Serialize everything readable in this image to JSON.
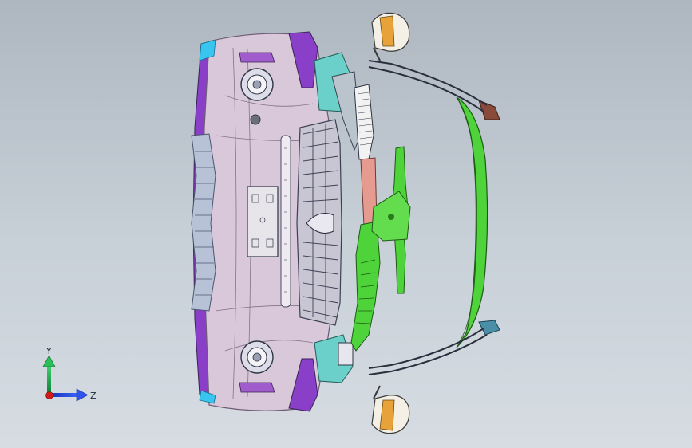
{
  "viewport": {
    "background_top": "#aeb7c0",
    "background_bottom": "#d6dce2"
  },
  "model": {
    "colors": {
      "bumper": "#d8c8da",
      "bumper_edge": "#7b6a80",
      "purple_trim": "#8a3fc8",
      "grille": "#c9c6d4",
      "green_panel": "#4fd33a",
      "salmon_part": "#e69b91",
      "teal_bracket": "#6bd0c9",
      "headlamp_shell": "#f4f0e6",
      "headlamp_amber": "#e8a23a",
      "cyan_tip": "#38c6f0"
    }
  },
  "triad": {
    "x_axis_label": "Z",
    "y_axis_label": "Y",
    "x_axis_color": "#1f43e0",
    "y_axis_color": "#1aa34a",
    "z_axis_color": "#d11a1a"
  }
}
